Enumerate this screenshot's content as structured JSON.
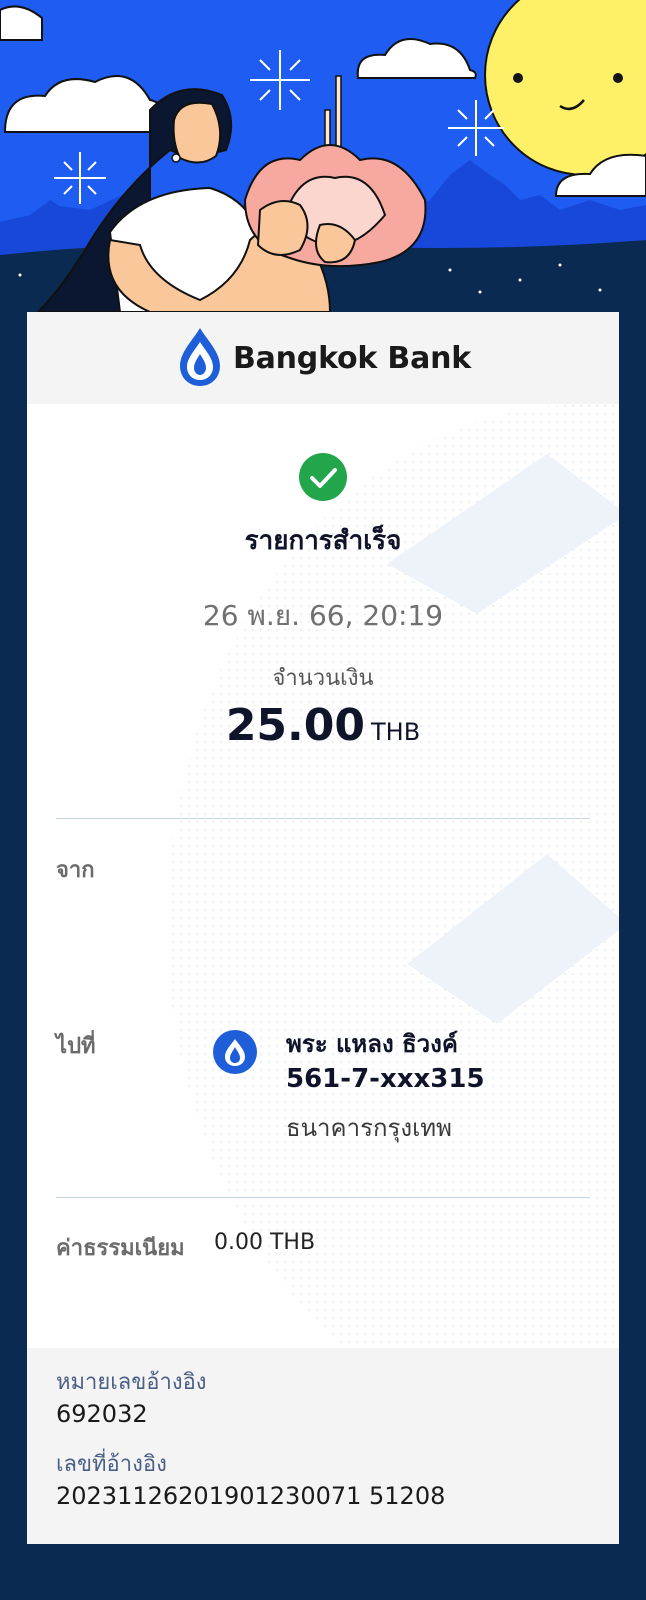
{
  "brand": {
    "name": "Bangkok Bank",
    "color": "#1e5fd9"
  },
  "status": {
    "title": "รายการสำเร็จ",
    "color": "#22a54b"
  },
  "transaction": {
    "datetime": "26 พ.ย. 66, 20:19",
    "amount_label": "จำนวนเงิน",
    "amount": "25.00",
    "currency": "THB"
  },
  "from": {
    "label": "จาก"
  },
  "to": {
    "label": "ไปที่",
    "name": "พระ แหลง ธิวงค์",
    "account": "561-7-xxx315",
    "bank": "ธนาคารกรุงเทพ"
  },
  "fee": {
    "label": "ค่าธรรมเนียม",
    "value": "0.00 THB"
  },
  "references": [
    {
      "label": "หมายเลขอ้างอิง",
      "value": "692032"
    },
    {
      "label": "เลขที่อ้างอิง",
      "value": "20231126201901230071 51208"
    }
  ]
}
